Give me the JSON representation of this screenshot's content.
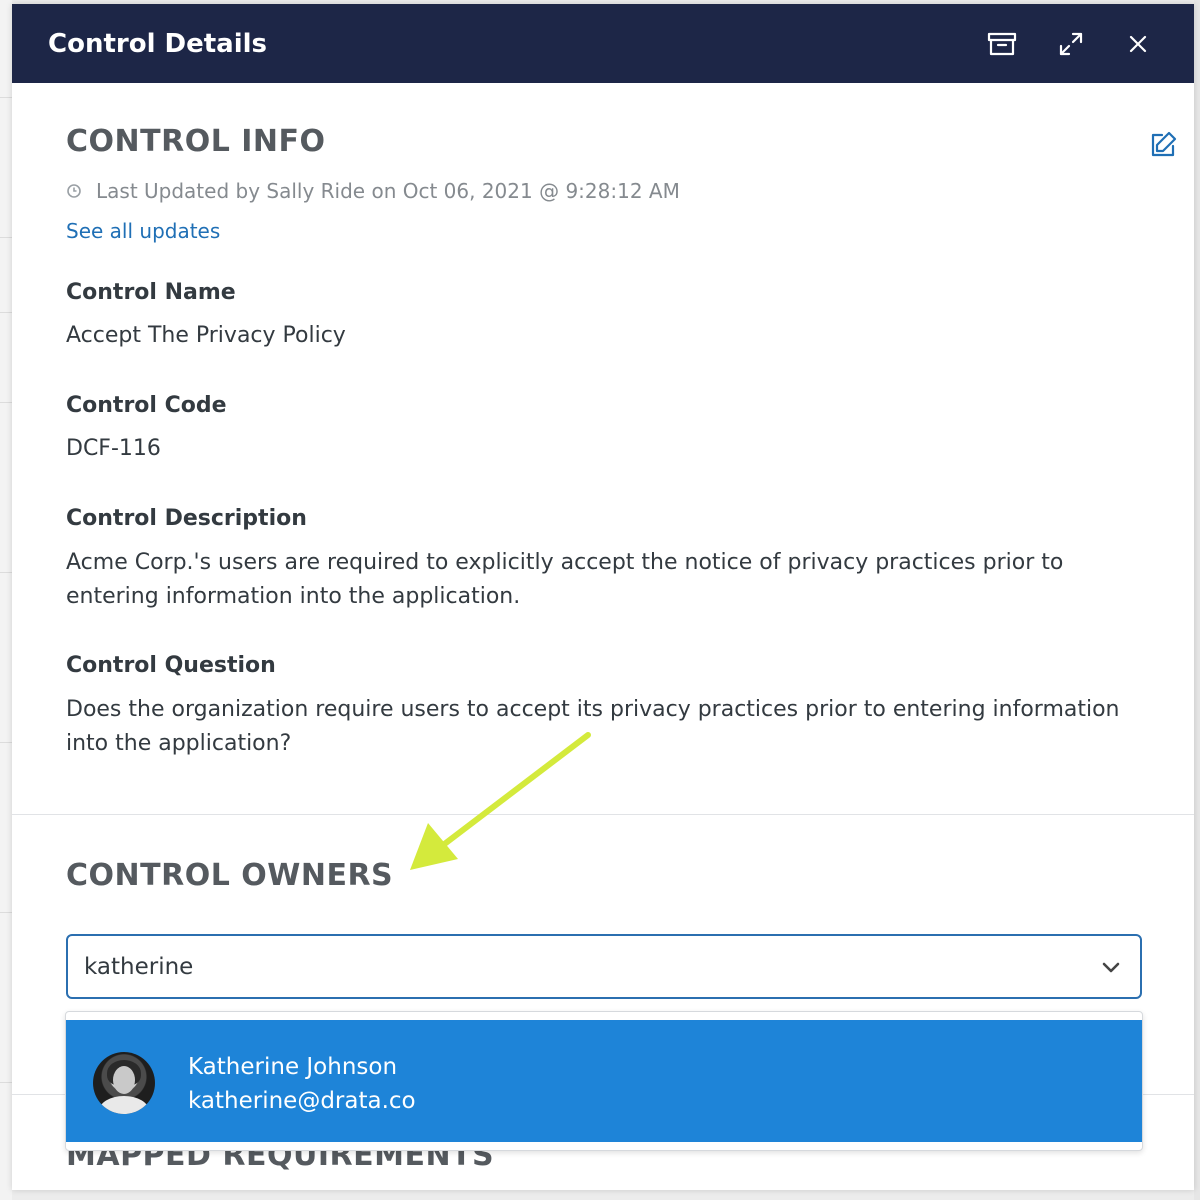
{
  "modal": {
    "title": "Control Details"
  },
  "control_info": {
    "heading": "CONTROL INFO",
    "last_updated": "Last Updated by Sally Ride on Oct 06, 2021 @ 9:28:12 AM",
    "see_all_updates": "See all updates",
    "fields": [
      {
        "label": "Control Name",
        "value": "Accept The Privacy Policy"
      },
      {
        "label": "Control Code",
        "value": "DCF-116"
      },
      {
        "label": "Control Description",
        "value": "Acme Corp.'s users are required to explicitly accept the notice of privacy practices prior to entering information into the application."
      },
      {
        "label": "Control Question",
        "value": "Does the organization require users to accept its privacy practices prior to entering information into the application?"
      }
    ]
  },
  "control_owners": {
    "heading": "CONTROL OWNERS",
    "search_value": "katherine",
    "options": [
      {
        "name": "Katherine Johnson",
        "email": "katherine@drata.co"
      }
    ]
  },
  "mapped_requirements": {
    "heading": "MAPPED REQUIREMENTS"
  },
  "colors": {
    "header_bg": "#1d2647",
    "link": "#1f6fb5",
    "option_selected": "#1e84d8",
    "annotation_arrow": "#d4ea3c"
  },
  "icons": [
    "archive-icon",
    "expand-icon",
    "close-icon",
    "edit-icon",
    "clock-icon",
    "chevron-down-icon"
  ]
}
